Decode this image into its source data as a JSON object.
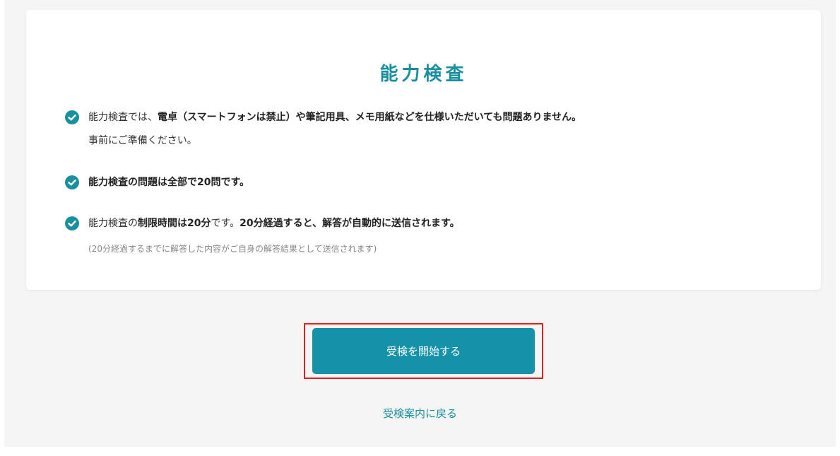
{
  "colors": {
    "accent": "#1a8fa0",
    "button": "#1592a8",
    "highlight": "#e41e1e",
    "background": "#f5f5f5"
  },
  "card": {
    "title": "能力検査",
    "items": [
      {
        "icon": "check-circle-icon",
        "p1": "能力検査では、",
        "p2": "電卓（スマートフォンは禁止）や筆記用具、メモ用紙などを仕様いただいても問題ありません。",
        "sub": "事前にご準備ください。"
      },
      {
        "icon": "check-circle-icon",
        "text": "能力検査の問題は全部で20問です。"
      },
      {
        "icon": "check-circle-icon",
        "p1": "能力検査の",
        "p2": "制限時間は20分",
        "p3": "です。",
        "p4": "20分経過すると、解答が自動的に送信されます。",
        "note": "(20分経過するまでに解答した内容がご自身の解答結果として送信されます)"
      }
    ]
  },
  "actions": {
    "start_label": "受検を開始する",
    "back_label": "受検案内に戻る"
  }
}
